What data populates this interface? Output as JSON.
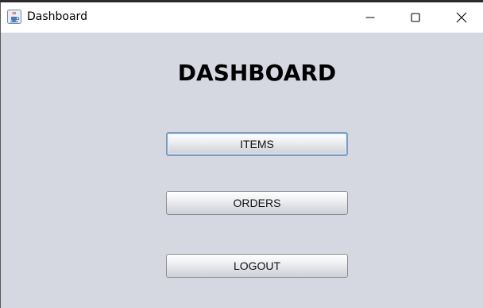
{
  "window": {
    "title": "Dashboard",
    "app_icon": "java-coffee-cup-icon",
    "controls": {
      "minimize": "minimize-icon",
      "maximize": "maximize-icon",
      "close": "close-icon"
    }
  },
  "main": {
    "heading": "DASHBOARD",
    "buttons": {
      "items": "ITEMS",
      "orders": "ORDERS",
      "logout": "LOGOUT"
    }
  },
  "colors": {
    "background": "#d5d8e0",
    "titlebar": "#ffffff",
    "focus_border": "#7d9bc0"
  }
}
